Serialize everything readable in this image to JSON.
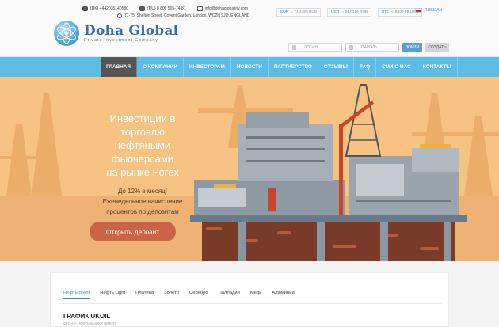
{
  "header": {
    "phone_uk": "(UK) +442035140580",
    "phone_ru": "(RU) 8 800 505-74-81",
    "email": "info@dohaglobalinv.com",
    "address": "71-75, Shelton Street, Covent Garden, London, WC2H 9JQ, ENGLAND",
    "rates": [
      {
        "code": "EUR",
        "value": "= 71,4785 RUB"
      },
      {
        "code": "USD",
        "value": "= 64,0316 RUB"
      },
      {
        "code": "BTC",
        "value": "= 6309.05 USD"
      }
    ],
    "language": "RUSSIAN",
    "login_placeholder": "ЛОГИН",
    "password_placeholder": "ПАРОЛЬ",
    "login_button": "ВОЙТИ",
    "register_button": "СОЗДАТЬ"
  },
  "logo": {
    "name": "Doha Global",
    "tagline": "Private Investment Company"
  },
  "nav": {
    "items": [
      {
        "label": "ГЛАВНАЯ"
      },
      {
        "label": "О КОМПАНИИ"
      },
      {
        "label": "ИНВЕСТОРАМ"
      },
      {
        "label": "НОВОСТИ"
      },
      {
        "label": "ПАРТНЕРСТВО"
      },
      {
        "label": "ОТЗЫВЫ"
      },
      {
        "label": "FAQ"
      },
      {
        "label": "СМИ О НАС"
      },
      {
        "label": "КОНТАКТЫ"
      }
    ]
  },
  "hero": {
    "title_line1": "Инвестиции в торговлю",
    "title_line2": "нефтяными фьючерсами",
    "title_line3": "на рынке Forex",
    "sub_line1": "До 12% в месяц!",
    "sub_line2": "Еженедельное начисление",
    "sub_line3": "процентов по депозитам",
    "button": "Открыть депозит"
  },
  "tabs": [
    {
      "label": "Нефть Brent"
    },
    {
      "label": "Нефть Light"
    },
    {
      "label": "Платина"
    },
    {
      "label": "Золото"
    },
    {
      "label": "Серебро"
    },
    {
      "label": "Палладий"
    },
    {
      "label": "Медь"
    },
    {
      "label": "Алюминий"
    }
  ],
  "chart_section": {
    "title": "ГРАФИК UKOIL",
    "subtitle": "CFD НА НЕФТЬ МАРКИ BRENT"
  },
  "colors": {
    "nav_bg": "#5bbce6",
    "nav_active": "#555555",
    "hero_bg": "#f6c382",
    "cta": "#c96445",
    "accent": "#3a8ac4"
  }
}
